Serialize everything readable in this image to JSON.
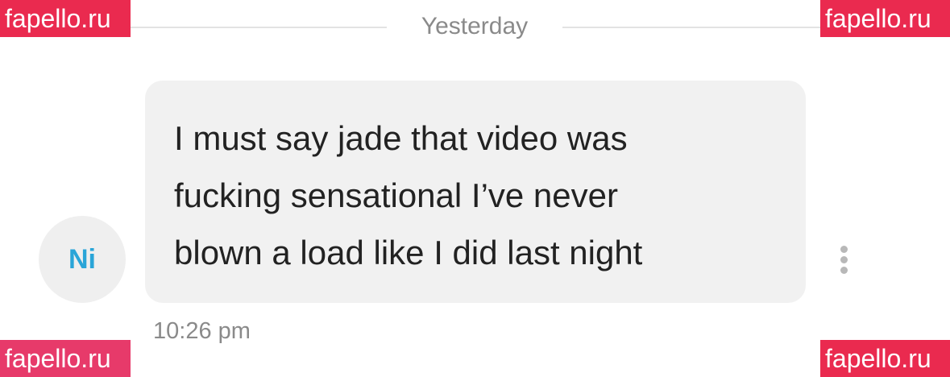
{
  "conversation": {
    "date_separator": "Yesterday",
    "message": {
      "sender_initials": "Ni",
      "lines": [
        "I must say jade that video was",
        "fucking sensational I’ve never",
        "blown a load like I did last night"
      ],
      "time": "10:26 pm"
    },
    "more_icon": "more-vertical-icon"
  },
  "watermarks": {
    "top_left": "fapello.ru",
    "top_right": "fapello.ru",
    "bottom_left": "fapello.ru",
    "bottom_right": "fapello.ru"
  },
  "colors": {
    "avatar_initials": "#2aa5d8",
    "bubble_background": "#f1f1f1",
    "watermark_background": "#ea2a4f",
    "muted_text": "#8a8a8a"
  }
}
